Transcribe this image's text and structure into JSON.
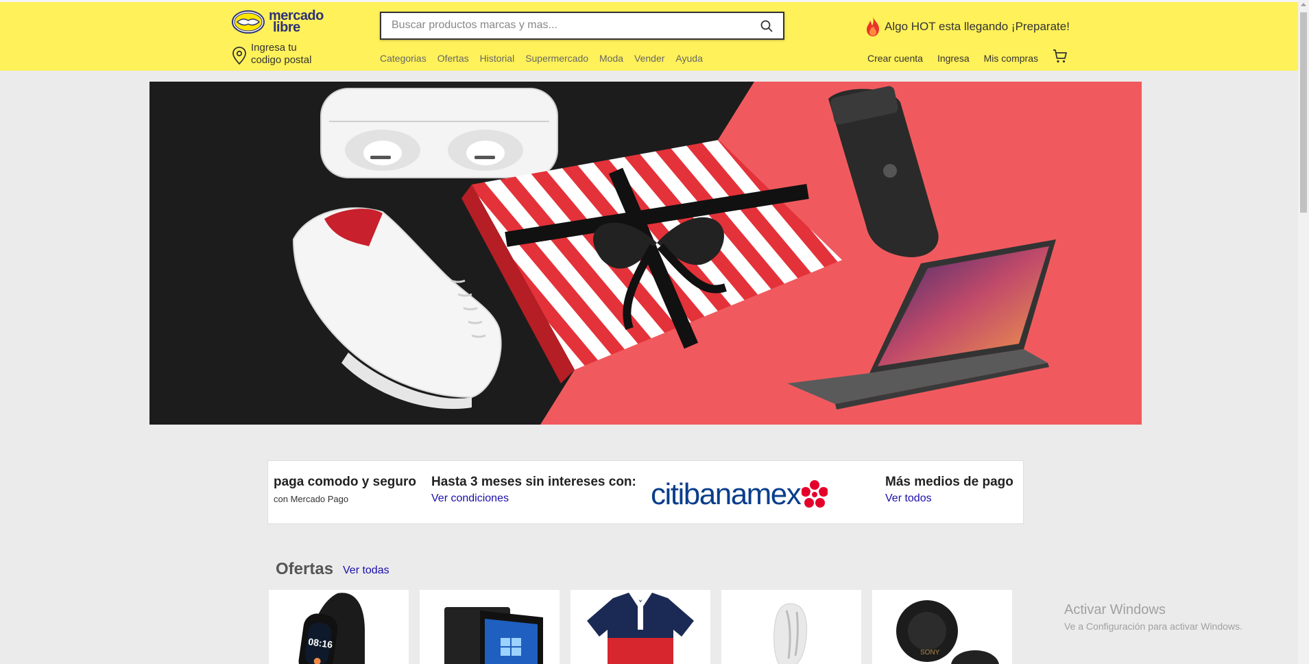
{
  "header": {
    "logo_line1": "mercado",
    "logo_line2": "libre",
    "location_line1": "Ingresa tu",
    "location_line2": "codigo postal",
    "search_placeholder": "Buscar productos marcas y mas...",
    "nav": [
      "Categorias",
      "Ofertas",
      "Historial",
      "Supermercado",
      "Moda",
      "Vender",
      "Ayuda"
    ],
    "promo": "Algo HOT esta llegando ¡Preparate!",
    "user_links": [
      "Crear cuenta",
      "Ingresa",
      "Mis compras"
    ]
  },
  "payment": {
    "block1_title": "paga comodo y seguro",
    "block1_sub": "con Mercado Pago",
    "block2_title": "Hasta 3 meses sin intereses con:",
    "block2_link": "Ver condiciones",
    "bank_logo": "citibanamex",
    "block3_title": "Más medios de pago",
    "block3_link": "Ver todos"
  },
  "ofertas": {
    "title": "Ofertas",
    "link": "Ver todas",
    "cards": [
      "smartband",
      "laptop",
      "polo-shirt",
      "figurine",
      "earbuds"
    ]
  },
  "watermark": {
    "line1": "Activar Windows",
    "line2": "Ve a Configuración para activar Windows."
  },
  "colors": {
    "header_bg": "#fff159",
    "link_blue": "#1a0dab",
    "hero_red": "#f05a5e"
  }
}
